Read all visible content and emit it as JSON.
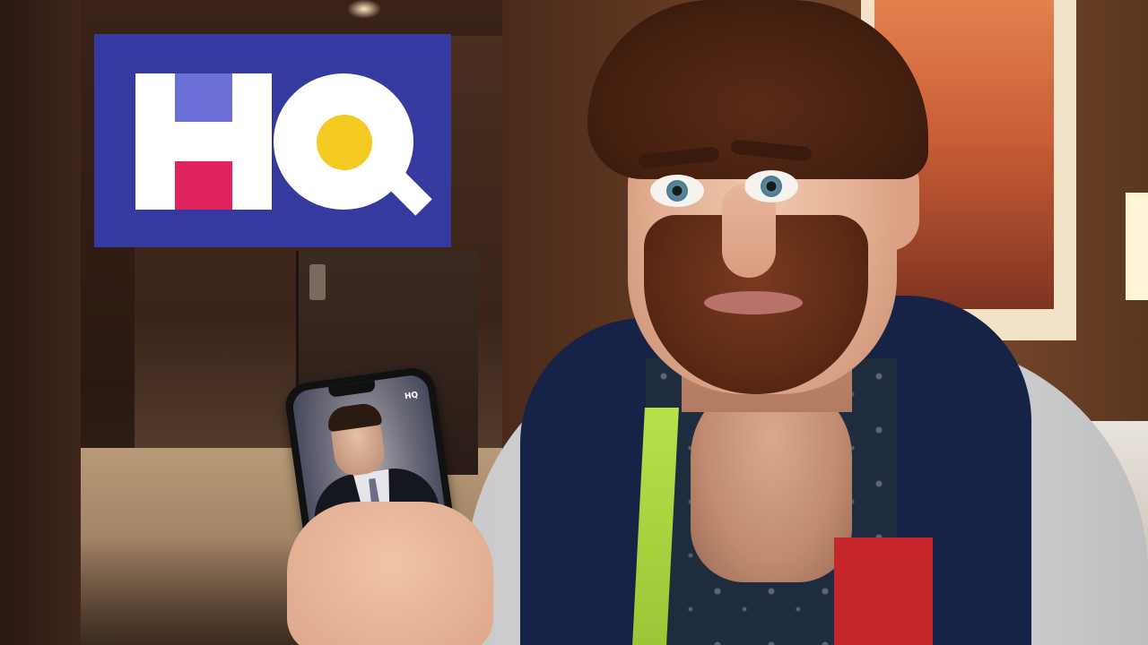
{
  "logo": {
    "text": "HQ",
    "colors": {
      "background": "#353b9e",
      "letters": "#ffffff",
      "h_top_block": "#6b6fd6",
      "h_bottom_block": "#e0245e",
      "q_center": "#f3c922"
    }
  },
  "phone": {
    "app_mark": "HQ"
  }
}
